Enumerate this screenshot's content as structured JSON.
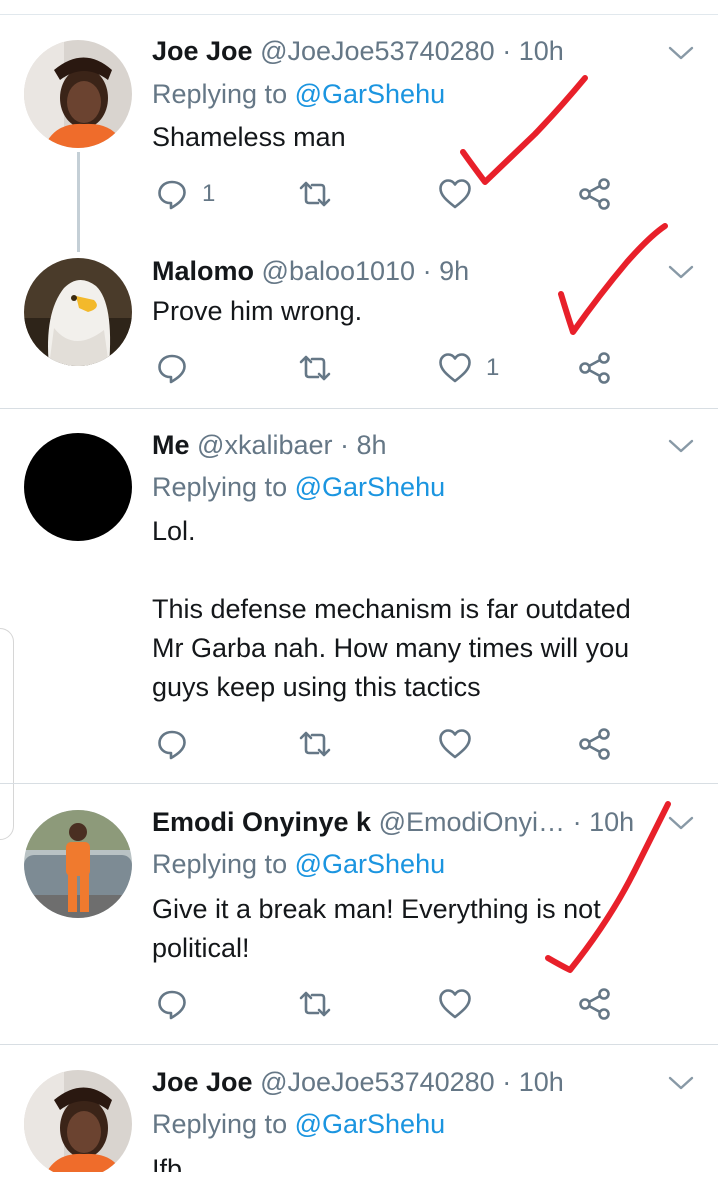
{
  "tweets": [
    {
      "name": "Joe Joe",
      "handle": "@JoeJoe53740280",
      "time": "10h",
      "replying_prefix": "Replying to",
      "replying_to": "@GarShehu",
      "text": "Shameless man",
      "reply_count": "1",
      "retweet_count": "",
      "like_count": ""
    },
    {
      "name": "Malomo",
      "handle": "@baloo1010",
      "time": "9h",
      "text": "Prove him wrong.",
      "reply_count": "",
      "retweet_count": "",
      "like_count": "1"
    },
    {
      "name": "Me",
      "handle": "@xkalibaer",
      "time": "8h",
      "replying_prefix": "Replying to",
      "replying_to": "@GarShehu",
      "text": "Lol.\n\nThis defense mechanism is far outdated\nMr Garba nah. How many times will you\nguys keep using this tactics",
      "reply_count": "",
      "retweet_count": "",
      "like_count": ""
    },
    {
      "name": "Emodi Onyinye k",
      "handle": "@EmodiOnyi…",
      "time": "10h",
      "replying_prefix": "Replying to",
      "replying_to": "@GarShehu",
      "text": "Give it a break man! Everything is not\npolitical!",
      "reply_count": "",
      "retweet_count": "",
      "like_count": ""
    },
    {
      "name": "Joe Joe",
      "handle": "@JoeJoe53740280",
      "time": "10h",
      "replying_prefix": "Replying to",
      "replying_to": "@GarShehu",
      "text": "Ifb"
    }
  ],
  "colors": {
    "mention": "#1b95e0",
    "secondary_text": "#657786",
    "annotation_check": "#e8202a"
  },
  "icons": [
    "reply-icon",
    "retweet-icon",
    "like-icon",
    "share-icon",
    "chevron-down-icon"
  ]
}
